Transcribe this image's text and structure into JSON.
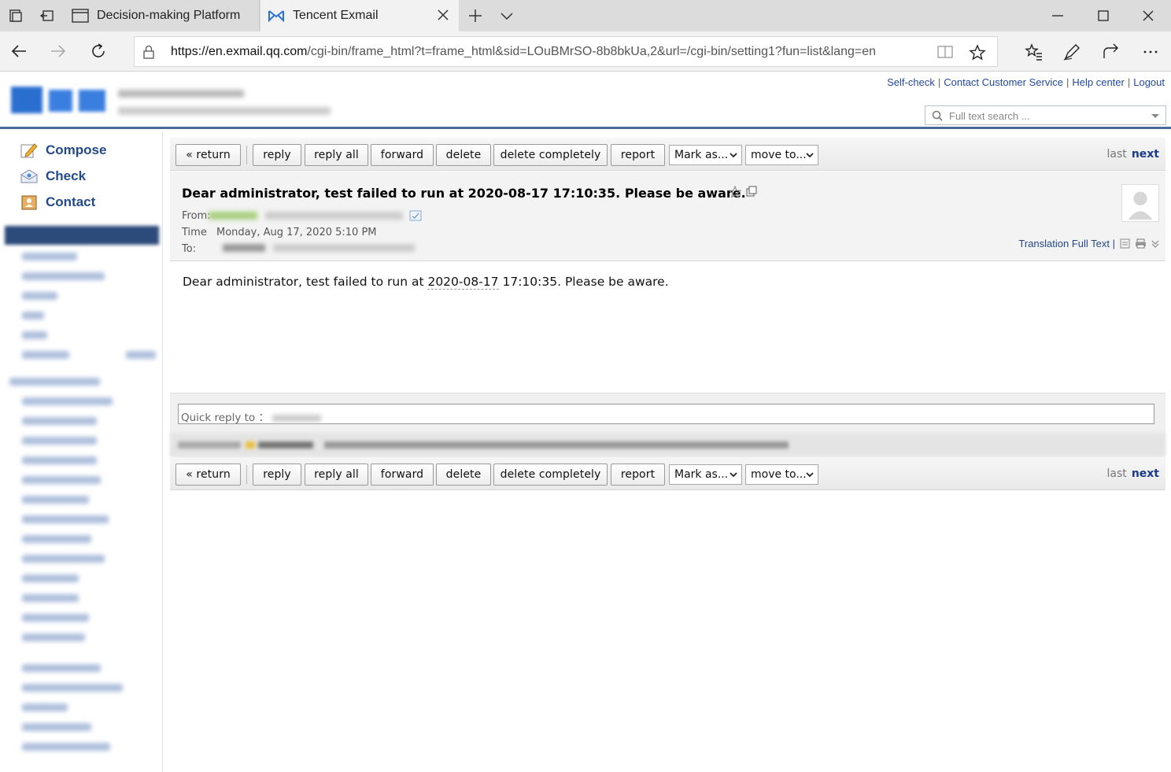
{
  "browser": {
    "tabs": [
      {
        "label": "Decision-making Platform"
      },
      {
        "label": "Tencent Exmail"
      }
    ],
    "url_host": "https://en.exmail.qq.com",
    "url_path": "/cgi-bin/frame_html?t=frame_html&sid=LOuBMrSO-8b8bkUa,2&url=/cgi-bin/setting1?fun=list&lang=en"
  },
  "header": {
    "links": [
      "Self-check",
      "Contact Customer Service",
      "Help center",
      "Logout"
    ],
    "search_placeholder": "Full text search ..."
  },
  "sidebar": {
    "actions": [
      {
        "label": "Compose"
      },
      {
        "label": "Check"
      },
      {
        "label": "Contact"
      }
    ]
  },
  "toolbar": {
    "return_label": "« return",
    "reply_label": "reply",
    "reply_all_label": "reply all",
    "forward_label": "forward",
    "delete_label": "delete",
    "delete_completely_label": "delete completely",
    "report_label": "report",
    "mark_as_label": "Mark as...",
    "move_to_label": "move to...",
    "last_label": "last",
    "next_label": "next"
  },
  "message": {
    "subject": "Dear administrator, test failed to run at 2020-08-17 17:10:35. Please be aware.",
    "from_label": "From:",
    "time_label": "Time",
    "time_value": "Monday, Aug 17, 2020 5:10 PM",
    "to_label": "To:",
    "translation_label": "Translation Full Text |",
    "body_prefix": "Dear administrator, test failed to run at ",
    "body_date": "2020-08-17",
    "body_suffix": " 17:10:35. Please be aware."
  },
  "quick_reply": {
    "label": "Quick reply to ："
  },
  "colors": {
    "accent": "#234a8a",
    "header_rule": "#4a6a9a"
  }
}
